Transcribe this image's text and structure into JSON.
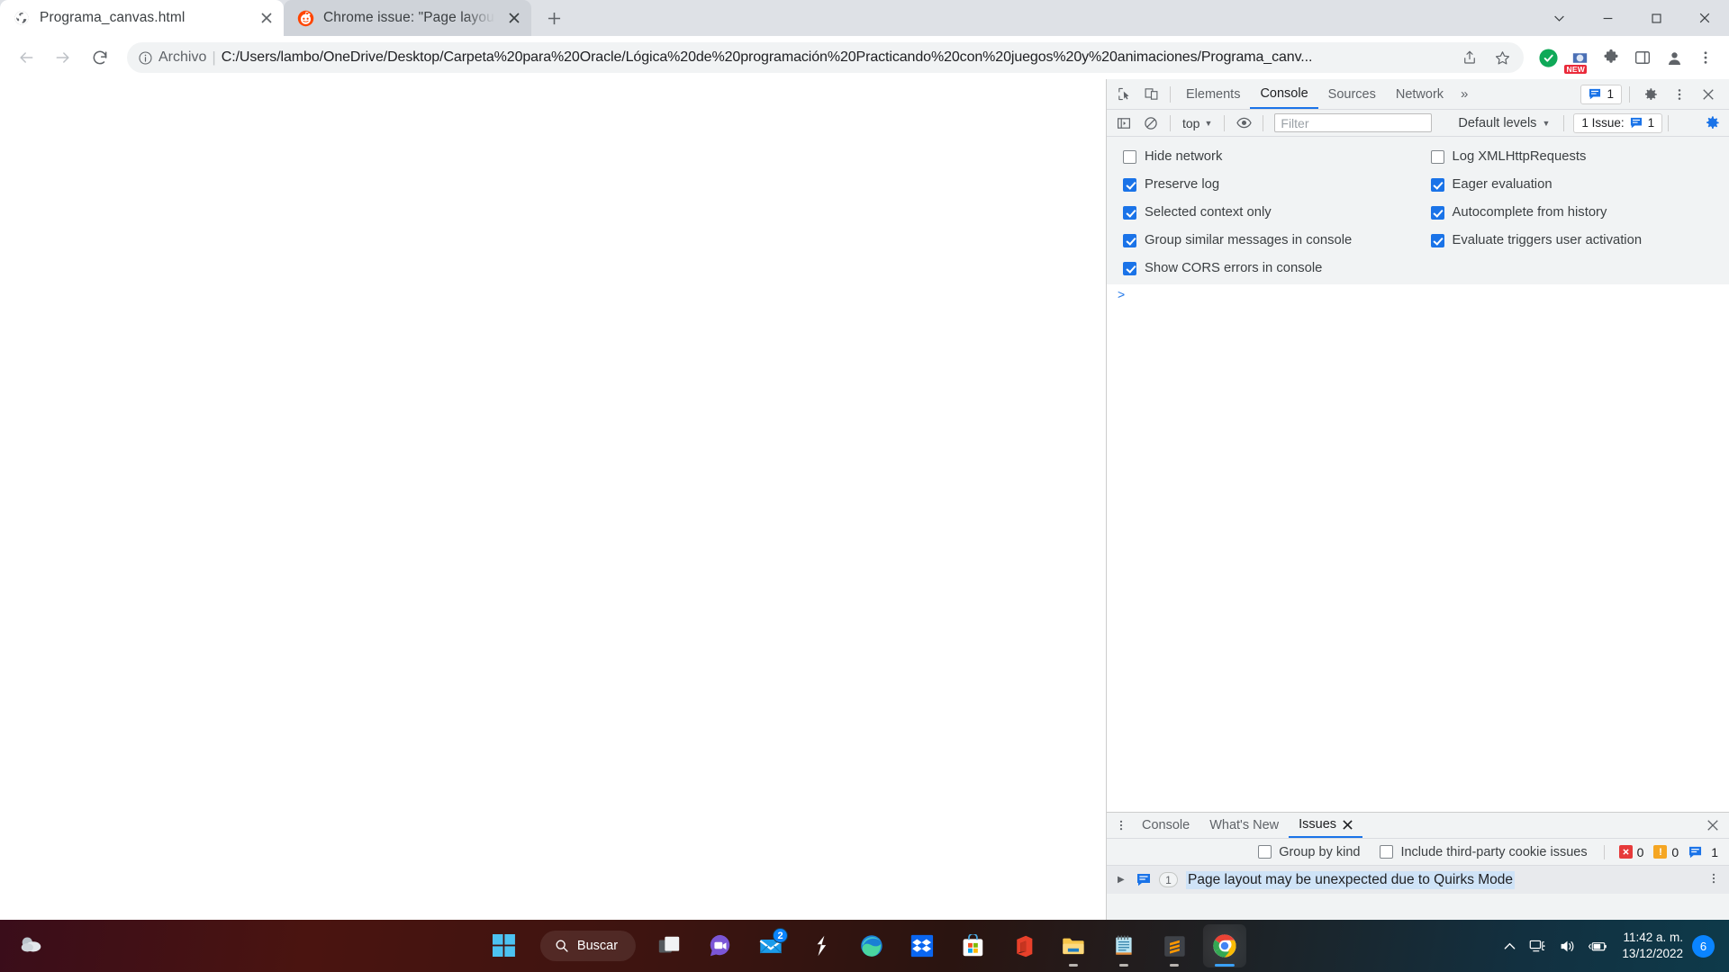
{
  "browser": {
    "tabs": [
      {
        "title": "Programa_canvas.html",
        "favicon": "globe-icon",
        "active": true
      },
      {
        "title": "Chrome issue: \"Page layout may",
        "favicon": "reddit-icon",
        "active": false
      }
    ],
    "new_tab_label": "+",
    "window_controls": {
      "minimize": "−",
      "maximize": "☐",
      "close": "✕",
      "chevron": "⌄"
    },
    "omnibox": {
      "scheme_label": "Archivo",
      "url": "C:/Users/lambo/OneDrive/Desktop/Carpeta%20para%20Oracle/Lógica%20de%20programación%20Practicando%20con%20juegos%20y%20animaciones/Programa_canv...",
      "back_icon": "back-arrow-icon",
      "forward_icon": "forward-arrow-icon",
      "reload_icon": "reload-icon",
      "info_icon": "info-circle-icon",
      "share_icon": "share-icon",
      "bookmark_icon": "star-icon",
      "extension_green_icon": "green-extension-icon",
      "extension_new_icon": "extension-new-badge-icon",
      "new_badge_text": "NEW",
      "extensions_icon": "puzzle-piece-icon",
      "sidepanel_icon": "side-panel-icon",
      "profile_icon": "profile-avatar-icon",
      "menu_icon": "three-dot-menu-icon"
    }
  },
  "devtools": {
    "inspect_icon": "inspect-element-icon",
    "device_icon": "device-toolbar-icon",
    "tabs": [
      {
        "label": "Elements",
        "selected": false
      },
      {
        "label": "Console",
        "selected": true
      },
      {
        "label": "Sources",
        "selected": false
      },
      {
        "label": "Network",
        "selected": false
      }
    ],
    "more_tabs": "»",
    "issue_pill": {
      "icon": "issue-message-icon",
      "count": "1"
    },
    "settings_icon": "gear-icon",
    "kebab_icon": "three-dot-menu-icon",
    "close_icon": "close-icon",
    "toolbar": {
      "sidebar_icon": "console-sidebar-icon",
      "clear_icon": "clear-console-icon",
      "context": "top",
      "eye_icon": "live-expression-eye-icon",
      "filter_placeholder": "Filter",
      "levels": "Default levels",
      "issues_label": "1 Issue:",
      "issues_count": "1",
      "gear_icon": "gear-icon"
    },
    "settings_panel": {
      "left": [
        {
          "label": "Hide network",
          "checked": false
        },
        {
          "label": "Preserve log",
          "checked": true
        },
        {
          "label": "Selected context only",
          "checked": true
        },
        {
          "label": "Group similar messages in console",
          "checked": true
        },
        {
          "label": "Show CORS errors in console",
          "checked": true
        }
      ],
      "right": [
        {
          "label": "Log XMLHttpRequests",
          "checked": false
        },
        {
          "label": "Eager evaluation",
          "checked": true
        },
        {
          "label": "Autocomplete from history",
          "checked": true
        },
        {
          "label": "Evaluate triggers user activation",
          "checked": true
        }
      ]
    },
    "console_prompt": ">",
    "drawer": {
      "kebab_icon": "three-dot-menu-icon",
      "tabs": [
        {
          "label": "Console",
          "selected": false,
          "closable": false
        },
        {
          "label": "What's New",
          "selected": false,
          "closable": false
        },
        {
          "label": "Issues",
          "selected": true,
          "closable": true
        }
      ],
      "close_icon": "close-icon",
      "filters": [
        {
          "label": "Group by kind",
          "checked": false
        },
        {
          "label": "Include third-party cookie issues",
          "checked": false
        }
      ],
      "counts": [
        {
          "kind": "error",
          "color": "#e63a3a",
          "glyph": "✕",
          "value": "0"
        },
        {
          "kind": "warning",
          "color": "#f5a623",
          "glyph": "!",
          "value": "0"
        },
        {
          "kind": "info",
          "color": "#1a73e8",
          "glyph": "▬",
          "value": "1"
        }
      ],
      "issue": {
        "expand_icon": "triangle-right-icon",
        "type_icon": "issue-message-icon",
        "count": "1",
        "title": "Page layout may be unexpected due to Quirks Mode",
        "kebab_icon": "three-dot-menu-icon"
      }
    }
  },
  "taskbar": {
    "weather_icon": "weather-cloud-icon",
    "start_icon": "windows-start-icon",
    "search_label": "Buscar",
    "search_icon": "search-icon",
    "items": [
      {
        "name": "task-view-icon",
        "running": false,
        "badge": null
      },
      {
        "name": "video-chat-icon",
        "running": false,
        "badge": null
      },
      {
        "name": "mail-icon",
        "running": false,
        "badge": "2"
      },
      {
        "name": "lightning-s-icon",
        "running": false,
        "badge": null
      },
      {
        "name": "microsoft-edge-icon",
        "running": false,
        "badge": null
      },
      {
        "name": "dropbox-icon",
        "running": false,
        "badge": null
      },
      {
        "name": "microsoft-store-icon",
        "running": false,
        "badge": null
      },
      {
        "name": "microsoft-office-icon",
        "running": false,
        "badge": null
      },
      {
        "name": "file-explorer-icon",
        "running": true,
        "badge": null
      },
      {
        "name": "notepad-icon",
        "running": true,
        "badge": null
      },
      {
        "name": "sublime-text-icon",
        "running": true,
        "badge": null
      },
      {
        "name": "google-chrome-icon",
        "running": true,
        "active": true,
        "badge": null
      }
    ],
    "tray": {
      "chevron_icon": "show-hidden-icons-chevron",
      "network_icon": "network-icon",
      "volume_icon": "volume-icon",
      "battery_icon": "battery-icon",
      "time": "11:42 a. m.",
      "date": "13/12/2022",
      "notification_count": "6"
    }
  },
  "colors": {
    "accent_blue": "#1a73e8",
    "tab_strip": "#dee1e6",
    "devtools_bg": "#f1f3f4",
    "highlight": "#cfe3f7"
  }
}
